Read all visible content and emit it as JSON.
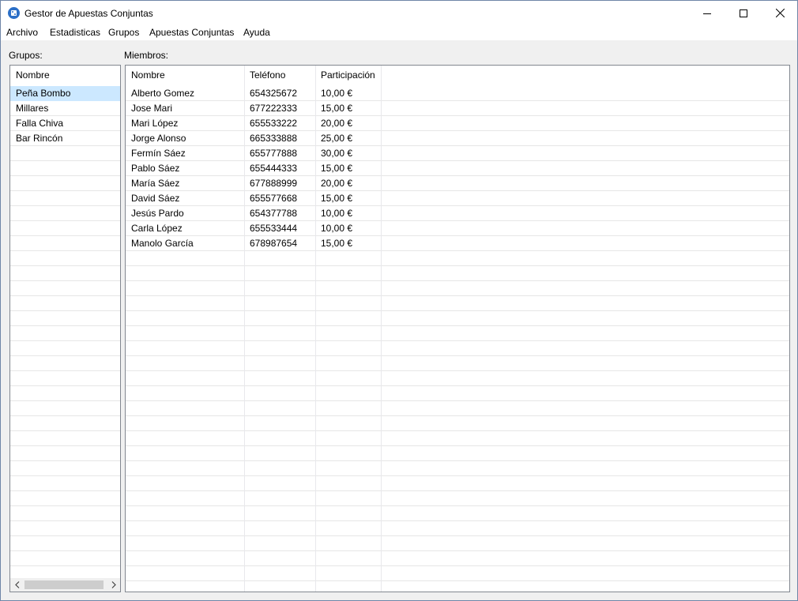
{
  "window": {
    "title": "Gestor de Apuestas Conjuntas"
  },
  "menu": [
    "Archivo",
    "Estadisticas",
    "Grupos",
    "Apuestas Conjuntas",
    "Ayuda"
  ],
  "groups": {
    "label": "Grupos:",
    "column": "Nombre",
    "selected_index": 0,
    "items": [
      "Peña Bombo",
      "Millares",
      "Falla Chiva",
      "Bar Rincón"
    ]
  },
  "members": {
    "label": "Miembros:",
    "columns": [
      "Nombre",
      "Teléfono",
      "Participación"
    ],
    "rows": [
      [
        "Alberto Gomez",
        "654325672",
        "10,00 €"
      ],
      [
        "Jose Mari",
        "677222333",
        "15,00 €"
      ],
      [
        "Mari López",
        "655533222",
        "20,00 €"
      ],
      [
        "Jorge Alonso",
        "665333888",
        "25,00 €"
      ],
      [
        "Fermín Sáez",
        "655777888",
        "30,00 €"
      ],
      [
        "Pablo Sáez",
        "655444333",
        "15,00 €"
      ],
      [
        "María Sáez",
        "677888999",
        "20,00 €"
      ],
      [
        "David Sáez",
        "655577668",
        "15,00 €"
      ],
      [
        "Jesús Pardo",
        "654377788",
        "10,00 €"
      ],
      [
        "Carla López",
        "655533444",
        "10,00 €"
      ],
      [
        "Manolo García",
        "678987654",
        "15,00 €"
      ]
    ]
  },
  "icons": {
    "app": "dice-icon",
    "minimize": "minimize-icon",
    "maximize": "maximize-icon",
    "close": "close-icon",
    "scroll_left": "chevron-left-icon",
    "scroll_right": "chevron-right-icon"
  },
  "colors": {
    "selection": "#cce8ff",
    "app_icon": "#2b6fc7",
    "panel_border": "#828790"
  }
}
